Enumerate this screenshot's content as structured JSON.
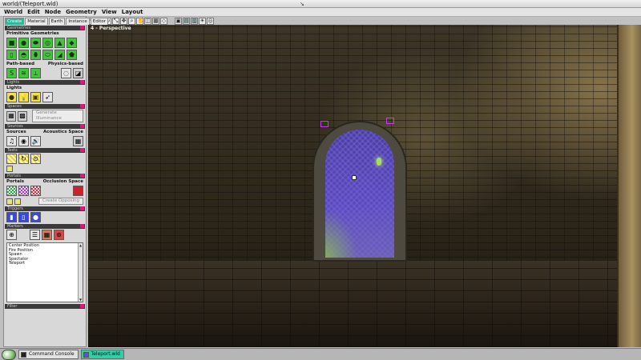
{
  "window": {
    "title": "world/(Teleport.wld)"
  },
  "menu": [
    "World",
    "Edit",
    "Node",
    "Geometry",
    "View",
    "Layout"
  ],
  "toolbar": {
    "group1_icons": [
      "cursor-icon",
      "select-icon",
      "rotate-icon",
      "scale-icon",
      "move-icon",
      "zoom-icon",
      "pan-icon",
      "snap-icon",
      "grid-icon",
      "wire-icon"
    ],
    "group2_icons": [
      "camera-icon",
      "render-icon",
      "light-toggle-icon",
      "settings-icon",
      "help-icon"
    ]
  },
  "panel": {
    "tabs": [
      "Create",
      "Material",
      "Earth",
      "Instance",
      "Editor"
    ],
    "active_tab": "Create",
    "sections": {
      "geometries": {
        "header": "Geometries",
        "primitive_label": "Primitive Geometries",
        "path_label": "Path-based",
        "physics_label": "Physics-based"
      },
      "lights": {
        "header": "Lights",
        "label": "Lights"
      },
      "spaces": {
        "header": "Spaces",
        "generate_button": "Generate Illuminance"
      },
      "sources": {
        "header": "Sources",
        "label": "Sources",
        "acoustics_label": "Acoustics Space"
      },
      "texts": {
        "header": "Texts"
      },
      "portals": {
        "header": "Portals",
        "label": "Portals",
        "occlusion_label": "Occlusion Space",
        "create_button": "Create Opposing"
      },
      "triggers": {
        "header": "Triggers"
      },
      "markers": {
        "header": "Markers",
        "items": [
          "Center Position",
          "Fire Position",
          "Spawn",
          "Spectator",
          "Teleport"
        ]
      },
      "filters": {
        "header": "Filter"
      }
    }
  },
  "viewport": {
    "label": "4 - Perspective"
  },
  "taskbar": {
    "items": [
      "Command Console",
      "Teleport.wld"
    ],
    "active": "Teleport.wld"
  },
  "colors": {
    "accent": "#2eb89a",
    "section_marker": "#d0207c",
    "portal": "#5b4bb8"
  }
}
